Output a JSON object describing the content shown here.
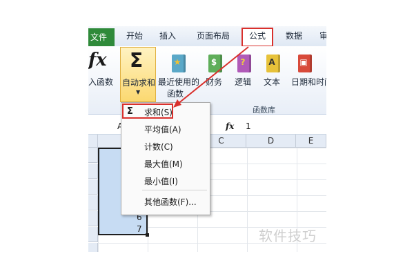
{
  "ribbon_tabs": {
    "file": "文件",
    "home": "开始",
    "insert": "插入",
    "page_layout": "页面布局",
    "formulas": "公式",
    "data": "数据",
    "review": "审"
  },
  "ribbon": {
    "insert_function": "入函数",
    "autosum_line1": "自动求和",
    "recent_line1": "最近使用的",
    "recent_line2": "函数",
    "financial": "财务",
    "logical": "逻辑",
    "text": "文本",
    "datetime": "日期和时间",
    "group_label": "函数库",
    "fx_glyph": "fx",
    "sigma_glyph": "Σ"
  },
  "autosum_menu": {
    "sigma": "Σ",
    "items": [
      "求和(S)",
      "平均值(A)",
      "计数(C)",
      "最大值(M)",
      "最小值(I)",
      "其他函数(F)..."
    ]
  },
  "formula_bar": {
    "name_box_partial": "A",
    "fx_label": "fx",
    "value": "1"
  },
  "grid": {
    "col_headers": [
      "C",
      "D",
      "E"
    ],
    "visible_values": [
      "6",
      "7"
    ]
  },
  "watermark": "软件技巧",
  "colors": {
    "highlight_red": "#d9302c",
    "file_tab_green": "#2f8a3a",
    "selection_blue": "#c7dcf3",
    "autosum_gold": "#fbd870"
  }
}
